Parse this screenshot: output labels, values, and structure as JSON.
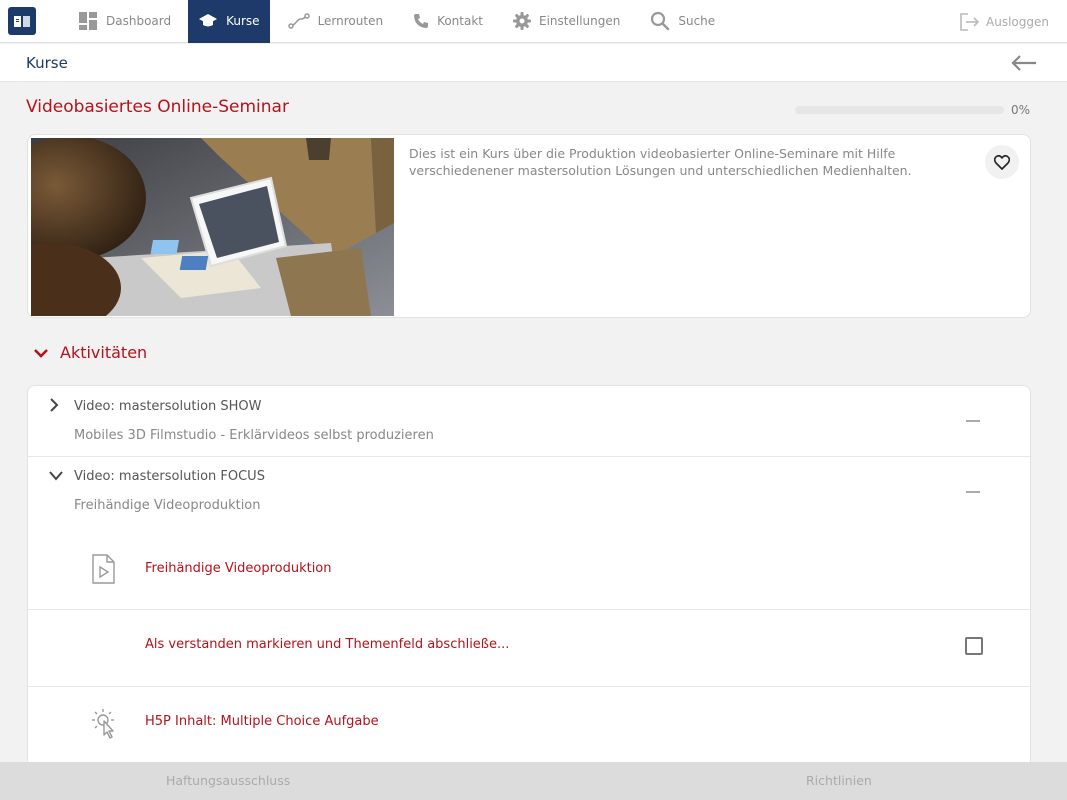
{
  "nav": {
    "items": [
      {
        "label": "Dashboard",
        "icon": "dashboard-icon"
      },
      {
        "label": "Kurse",
        "icon": "graduation-cap-icon",
        "active": true
      },
      {
        "label": "Lernrouten",
        "icon": "route-icon"
      },
      {
        "label": "Kontakt",
        "icon": "phone-icon"
      },
      {
        "label": "Einstellungen",
        "icon": "gear-icon"
      },
      {
        "label": "Suche",
        "icon": "search-icon"
      }
    ],
    "logout_label": "Ausloggen",
    "active_color": "#1d3a6a"
  },
  "breadcrumb": {
    "title": "Kurse"
  },
  "course": {
    "title": "Videobasiertes Online-Seminar",
    "progress_percent": 0,
    "progress_label": "0%",
    "description": "Dies ist ein Kurs über die Produktion videobasierter Online-Seminare mit Hilfe verschiedenener mastersolution Lösungen und unterschiedlichen Medienhalten.",
    "accent_color": "#b5121b"
  },
  "activities": {
    "section_title": "Aktivitäten",
    "items": [
      {
        "title": "Video: mastersolution SHOW",
        "subtitle": "Mobiles 3D Filmstudio - Erklärvideos selbst produzieren",
        "expanded": false
      },
      {
        "title": "Video: mastersolution FOCUS",
        "subtitle": "Freihändige Videoproduktion",
        "expanded": true
      }
    ],
    "sub_items": [
      {
        "label": "Freihändige Videoproduktion",
        "icon": "video-file-icon"
      },
      {
        "label": "Als verstanden markieren und Themenfeld abschließe...",
        "icon": "",
        "checkbox": true
      },
      {
        "label": "H5P Inhalt: Multiple Choice Aufgabe",
        "icon": "interactive-click-icon"
      }
    ]
  },
  "footer": {
    "left_label": "Haftungsausschluss",
    "right_label": "Richtlinien"
  }
}
